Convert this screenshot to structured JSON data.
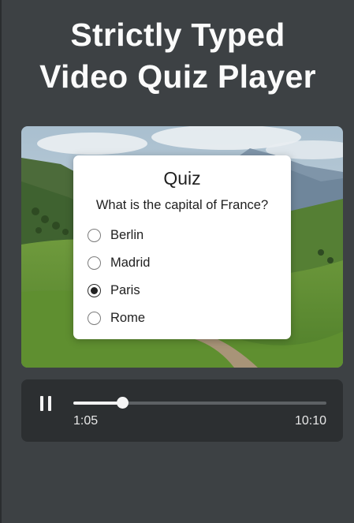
{
  "header": {
    "title_line1": "Strictly Typed",
    "title_line2": "Video Quiz Player"
  },
  "quiz": {
    "title": "Quiz",
    "question": "What is the capital of France?",
    "options": [
      {
        "label": "Berlin",
        "selected": false
      },
      {
        "label": "Madrid",
        "selected": false
      },
      {
        "label": "Paris",
        "selected": true
      },
      {
        "label": "Rome",
        "selected": false
      }
    ]
  },
  "player": {
    "state_icon": "pause-icon",
    "current_time": "1:05",
    "duration": "10:10",
    "progress": 0.1926
  }
}
